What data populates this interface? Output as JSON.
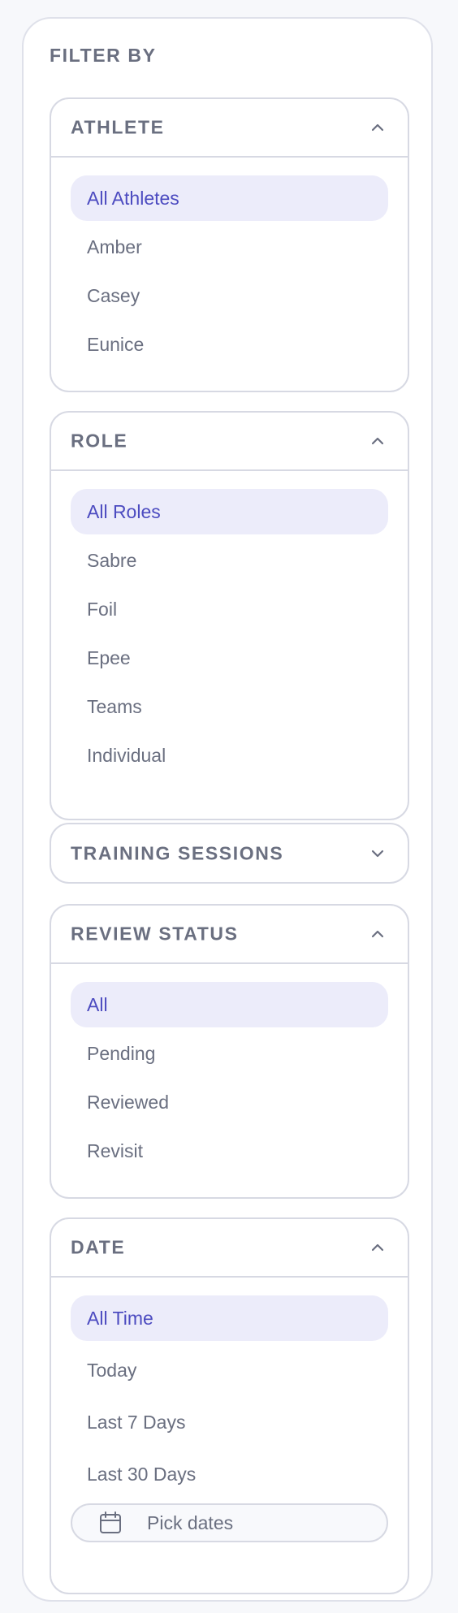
{
  "panel": {
    "title": "FILTER BY"
  },
  "sections": {
    "athlete": {
      "title": "ATHLETE",
      "expanded": true,
      "options": [
        "All Athletes",
        "Amber",
        "Casey",
        "Eunice"
      ],
      "selected": "All Athletes"
    },
    "role": {
      "title": "ROLE",
      "expanded": true,
      "options": [
        "All Roles",
        "Sabre",
        "Foil",
        "Epee",
        "Teams",
        "Individual"
      ],
      "selected": "All Roles"
    },
    "training": {
      "title": "TRAINING SESSIONS",
      "expanded": false
    },
    "review": {
      "title": "REVIEW STATUS",
      "expanded": true,
      "options": [
        "All",
        "Pending",
        "Reviewed",
        "Revisit"
      ],
      "selected": "All"
    },
    "date": {
      "title": "DATE",
      "expanded": true,
      "options": [
        "All Time",
        "Today",
        "Last 7 Days",
        "Last 30 Days"
      ],
      "selected": "All Time",
      "pick_dates_label": "Pick dates"
    }
  },
  "icons": {
    "expanded": "chevron-up-icon",
    "collapsed": "chevron-down-icon",
    "date_picker": "calendar-icon"
  },
  "colors": {
    "accent_text": "#4c4bc0",
    "accent_bg": "#ececfa",
    "muted_text": "#6a6f80",
    "border": "#d7d9e3"
  }
}
